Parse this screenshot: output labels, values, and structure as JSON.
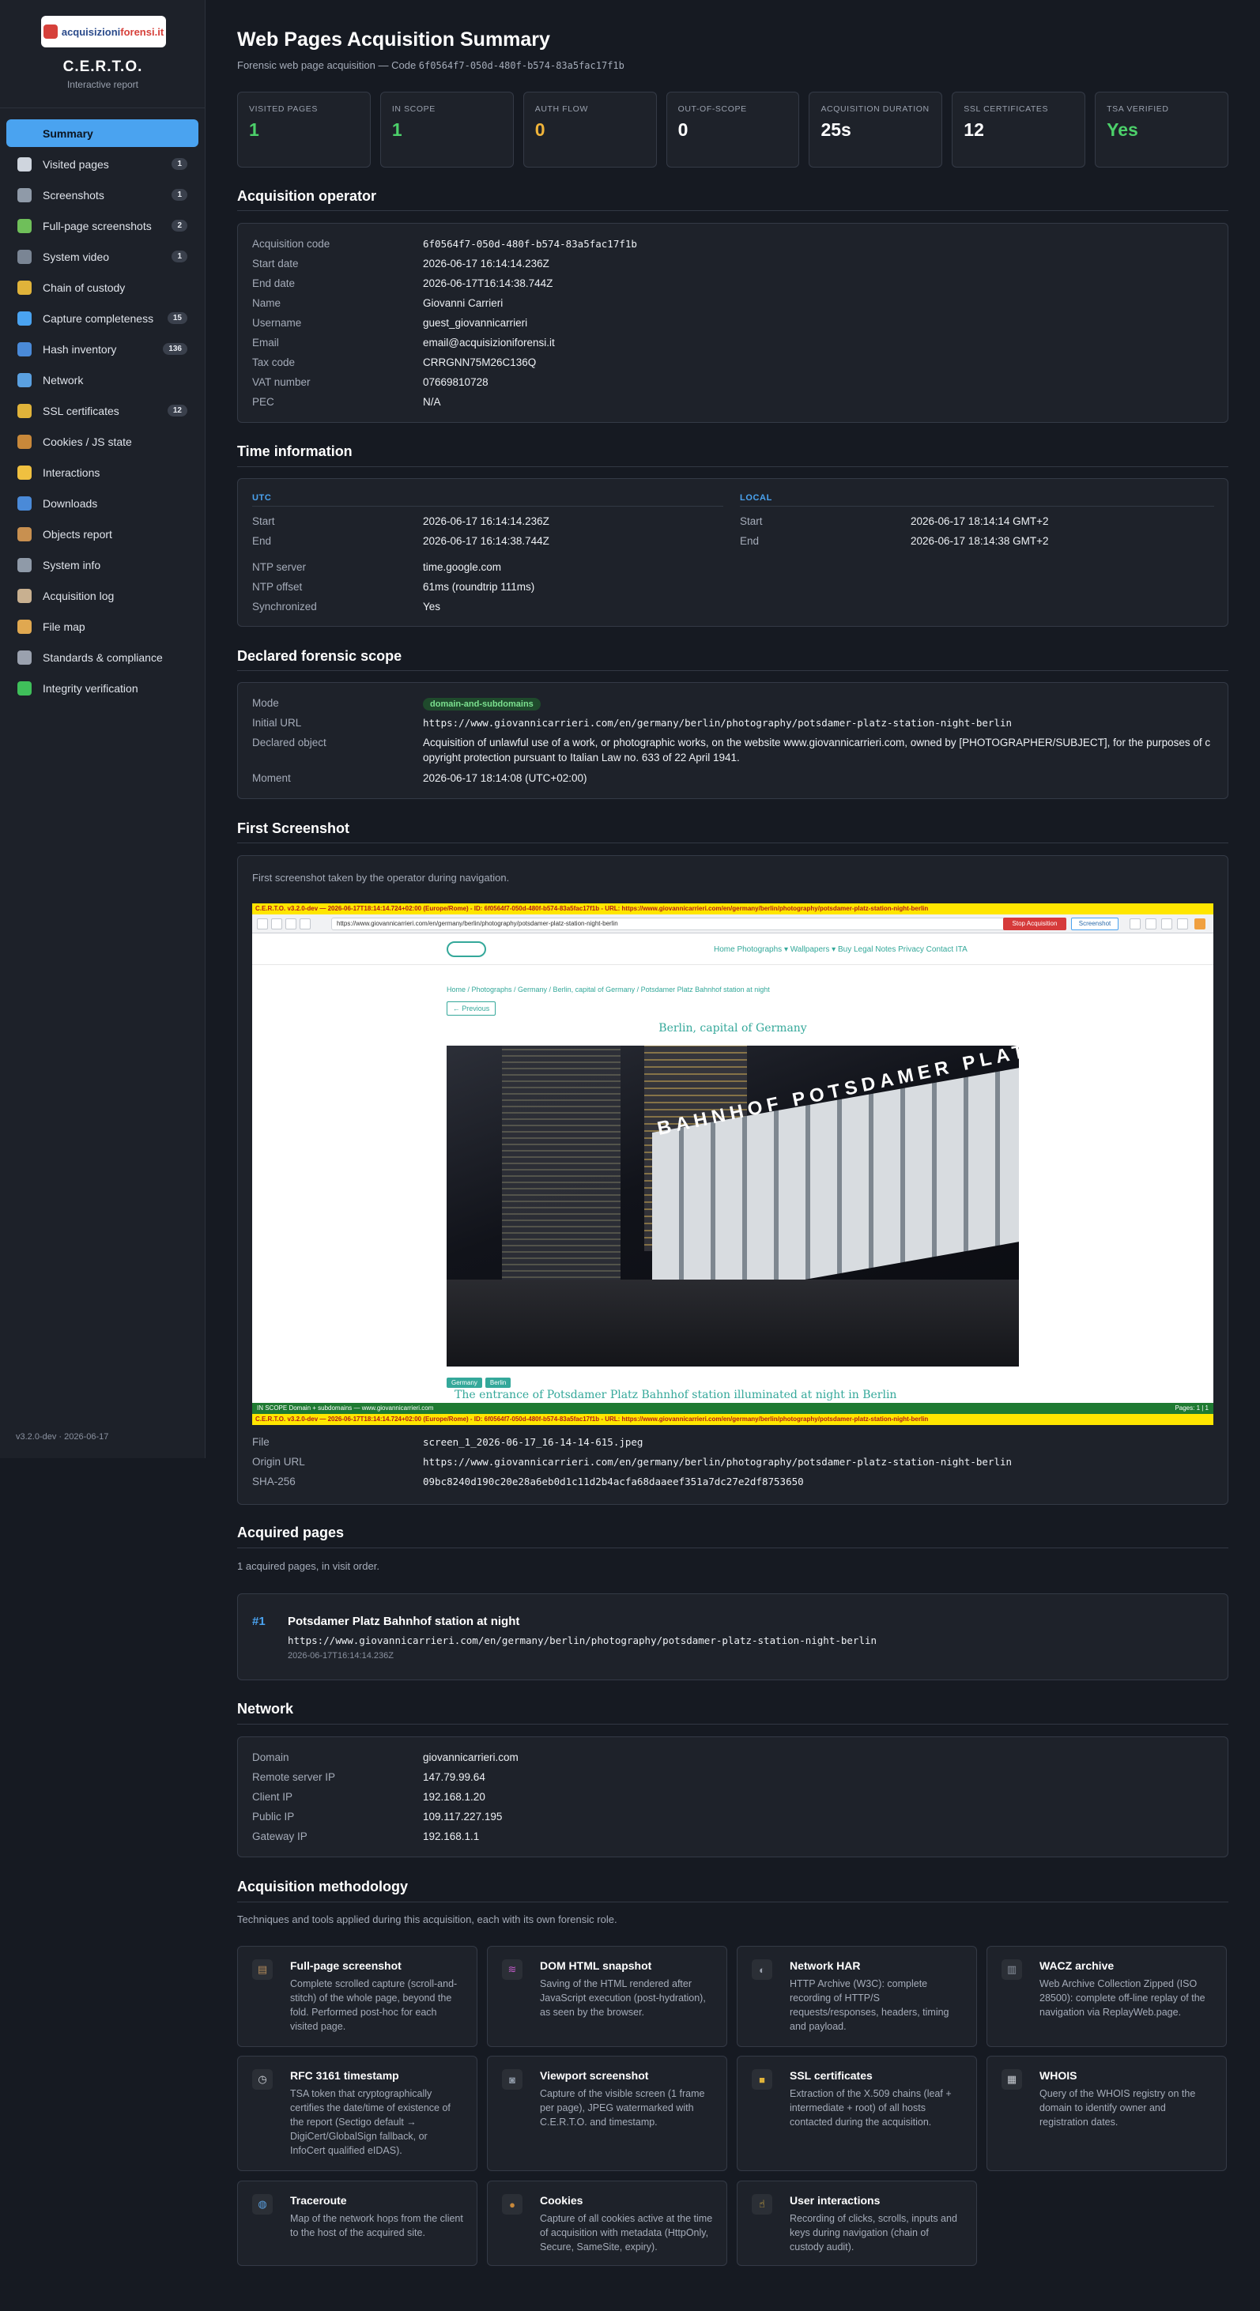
{
  "sidebar": {
    "logo_text_a": "acquisizioni",
    "logo_text_b": "forensi.it",
    "title": "C.E.R.T.O.",
    "subtitle": "Interactive report",
    "items": [
      {
        "label": "Summary",
        "badge": "",
        "icon": "bar-chart-icon",
        "color": "#4aa3f0"
      },
      {
        "label": "Visited pages",
        "badge": "1",
        "icon": "page-icon",
        "color": "#cfd5de"
      },
      {
        "label": "Screenshots",
        "badge": "1",
        "icon": "camera-icon",
        "color": "#8f9aa8"
      },
      {
        "label": "Full-page screenshots",
        "badge": "2",
        "icon": "picture-icon",
        "color": "#6fbf5a"
      },
      {
        "label": "System video",
        "badge": "1",
        "icon": "video-camera-icon",
        "color": "#7a8594"
      },
      {
        "label": "Chain of custody",
        "badge": "",
        "icon": "lock-key-icon",
        "color": "#e0b33a"
      },
      {
        "label": "Capture completeness",
        "badge": "15",
        "icon": "chart-icon",
        "color": "#4aa3f0"
      },
      {
        "label": "Hash inventory",
        "badge": "136",
        "icon": "hash-icon",
        "color": "#4a8ad8"
      },
      {
        "label": "Network",
        "badge": "",
        "icon": "globe-icon",
        "color": "#5aa0e0"
      },
      {
        "label": "SSL certificates",
        "badge": "12",
        "icon": "lock-icon",
        "color": "#e0b33a"
      },
      {
        "label": "Cookies / JS state",
        "badge": "",
        "icon": "cookie-icon",
        "color": "#c8883a"
      },
      {
        "label": "Interactions",
        "badge": "",
        "icon": "pointing-hand-icon",
        "color": "#f0c040"
      },
      {
        "label": "Downloads",
        "badge": "",
        "icon": "download-icon",
        "color": "#4a8ad8"
      },
      {
        "label": "Objects report",
        "badge": "",
        "icon": "box-icon",
        "color": "#c89050"
      },
      {
        "label": "System info",
        "badge": "",
        "icon": "laptop-icon",
        "color": "#8f9aa8"
      },
      {
        "label": "Acquisition log",
        "badge": "",
        "icon": "clipboard-icon",
        "color": "#c8b090"
      },
      {
        "label": "File map",
        "badge": "",
        "icon": "folder-icon",
        "color": "#e0a850"
      },
      {
        "label": "Standards & compliance",
        "badge": "",
        "icon": "gear-icon",
        "color": "#9aa1ae"
      },
      {
        "label": "Integrity verification",
        "badge": "",
        "icon": "check-icon",
        "color": "#3fbf5a"
      }
    ],
    "version": "v3.2.0-dev · 2026-06-17"
  },
  "header": {
    "title": "Web Pages Acquisition Summary",
    "subtitle_prefix": "Forensic web page acquisition — Code ",
    "code": "6f0564f7-050d-480f-b574-83a5fac17f1b"
  },
  "stats": [
    {
      "label": "VISITED PAGES",
      "value": "1",
      "color": "#4cd06a"
    },
    {
      "label": "IN SCOPE",
      "value": "1",
      "color": "#4cd06a"
    },
    {
      "label": "AUTH FLOW",
      "value": "0",
      "color": "#f0b43a"
    },
    {
      "label": "OUT-OF-SCOPE",
      "value": "0",
      "color": "#ffffff"
    },
    {
      "label": "ACQUISITION DURATION",
      "value": "25s",
      "color": "#ffffff"
    },
    {
      "label": "SSL CERTIFICATES",
      "value": "12",
      "color": "#ffffff"
    },
    {
      "label": "TSA VERIFIED",
      "value": "Yes",
      "color": "#4cd06a"
    }
  ],
  "operator": {
    "title": "Acquisition operator",
    "rows": [
      {
        "k": "Acquisition code",
        "v": "6f0564f7-050d-480f-b574-83a5fac17f1b"
      },
      {
        "k": "Start date",
        "v": "2026-06-17 16:14:14.236Z"
      },
      {
        "k": "End date",
        "v": "2026-06-17T16:14:38.744Z"
      },
      {
        "k": "Name",
        "v": "Giovanni Carrieri"
      },
      {
        "k": "Username",
        "v": "guest_giovannicarrieri"
      },
      {
        "k": "Email",
        "v": "email@acquisizioniforensi.it"
      },
      {
        "k": "Tax code",
        "v": "CRRGNN75M26C136Q"
      },
      {
        "k": "VAT number",
        "v": "07669810728"
      },
      {
        "k": "PEC",
        "v": "N/A"
      }
    ]
  },
  "time": {
    "title": "Time information",
    "utc_head": "UTC",
    "local_head": "LOCAL",
    "utc": [
      {
        "k": "Start",
        "v": "2026-06-17 16:14:14.236Z"
      },
      {
        "k": "End",
        "v": "2026-06-17 16:14:38.744Z"
      }
    ],
    "local": [
      {
        "k": "Start",
        "v": "2026-06-17 18:14:14 GMT+2"
      },
      {
        "k": "End",
        "v": "2026-06-17 18:14:38 GMT+2"
      }
    ],
    "ntp": [
      {
        "k": "NTP server",
        "v": "time.google.com"
      },
      {
        "k": "NTP offset",
        "v": "61ms (roundtrip 111ms)"
      },
      {
        "k": "Synchronized",
        "v": "Yes"
      }
    ]
  },
  "scope": {
    "title": "Declared forensic scope",
    "mode_k": "Mode",
    "mode_v": "domain-and-subdomains",
    "url_k": "Initial URL",
    "url_v": "https://www.giovannicarrieri.com/en/germany/berlin/photography/potsdamer-platz-station-night-berlin",
    "obj_k": "Declared object",
    "obj_v1": "Acquisition of unlawful use of a work, or photographic works, on the website www.giovannicarrieri.com, owned by [PHOTOGRAPHER/SUBJECT], for the purposes of c",
    "obj_v2": "opyright protection pursuant to Italian Law no. 633 of 22 April 1941.",
    "moment_k": "Moment",
    "moment_v": "2026-06-17 18:14:08 (UTC+02:00)"
  },
  "first_shot": {
    "title": "First Screenshot",
    "desc": "First screenshot taken by the operator during navigation.",
    "banner": "C.E.R.T.O. v3.2.0-dev — 2026-06-17T18:14:14.724+02:00 (Europe/Rome) - ID: 6f0564f7-050d-480f-b574-83a5fac17f1b - URL: https://www.giovannicarrieri.com/en/germany/berlin/photography/potsdamer-platz-station-night-berlin",
    "browser_url": "https://www.giovannicarrieri.com/en/germany/berlin/photography/potsdamer-platz-station-night-berlin",
    "stop_label": "Stop Acquisition",
    "shot_label": "Screenshot",
    "site_menu": "Home   Photographs ▾   Wallpapers ▾   Buy   Legal Notes   Privacy   Contact      ITA",
    "site_crumbs": "Home  /  Photographs  /  Germany  /  Berlin, capital of Germany  /  Potsdamer Platz Bahnhof station at night",
    "prev_label": "← Previous",
    "page_heading": "Berlin, capital of Germany",
    "photo_sign": "BAHNHOF POTSDAMER PLATZ",
    "tags": [
      "Germany",
      "Berlin"
    ],
    "caption": "The entrance of Potsdamer Platz Bahnhof station illuminated at night in Berlin",
    "scope_bar": "IN SCOPE   Domain + subdomains — www.giovannicarrieri.com",
    "pages_bar": "Pages: 1 | 1",
    "file_k": "File",
    "file_v": "screen_1_2026-06-17_16-14-14-615.jpeg",
    "origin_k": "Origin URL",
    "origin_v": "https://www.giovannicarrieri.com/en/germany/berlin/photography/potsdamer-platz-station-night-berlin",
    "sha_k": "SHA-256",
    "sha_v": "09bc8240d190c20e28a6eb0d1c11d2b4acfa68daaeef351a7dc27e2df8753650"
  },
  "acquired": {
    "title": "Acquired pages",
    "desc": "1 acquired pages, in visit order.",
    "num": "#1",
    "page_title": "Potsdamer Platz Bahnhof station at night",
    "url": "https://www.giovannicarrieri.com/en/germany/berlin/photography/potsdamer-platz-station-night-berlin",
    "time": "2026-06-17T16:14:14.236Z"
  },
  "network": {
    "title": "Network",
    "rows": [
      {
        "k": "Domain",
        "v": "giovannicarrieri.com"
      },
      {
        "k": "Remote server IP",
        "v": "147.79.99.64"
      },
      {
        "k": "Client IP",
        "v": "192.168.1.20"
      },
      {
        "k": "Public IP",
        "v": "109.117.227.195"
      },
      {
        "k": "Gateway IP",
        "v": "192.168.1.1"
      }
    ]
  },
  "methodology": {
    "title": "Acquisition methodology",
    "desc": "Techniques and tools applied during this acquisition, each with its own forensic role.",
    "items": [
      {
        "title": "Full-page screenshot",
        "desc": "Complete scrolled capture (scroll-and-stitch) of the whole page, beyond the fold. Performed post-hoc for each visited page.",
        "icon": "scroll-icon",
        "glyph": "▤",
        "color": "#b08a5a"
      },
      {
        "title": "DOM HTML snapshot",
        "desc": "Saving of the HTML rendered after JavaScript execution (post-hydration), as seen by the browser.",
        "icon": "dna-icon",
        "glyph": "≋",
        "color": "#c05ac8"
      },
      {
        "title": "Network HAR",
        "desc": "HTTP Archive (W3C): complete recording of HTTP/S requests/responses, headers, timing and payload.",
        "icon": "satellite-dish-icon",
        "glyph": "◐",
        "color": "#9aa1ae"
      },
      {
        "title": "WACZ archive",
        "desc": "Web Archive Collection Zipped (ISO 28500): complete off-line replay of the navigation via ReplayWeb.page.",
        "icon": "cabinet-icon",
        "glyph": "▥",
        "color": "#8a929e"
      },
      {
        "title": "RFC 3161 timestamp",
        "desc": "TSA token that cryptographically certifies the date/time of existence of the report (Sectigo default → DigiCert/GlobalSign fallback, or InfoCert qualified eIDAS).",
        "icon": "stopwatch-icon",
        "glyph": "◷",
        "color": "#d0d4da"
      },
      {
        "title": "Viewport screenshot",
        "desc": "Capture of the visible screen (1 frame per page), JPEG watermarked with C.E.R.T.O. and timestamp.",
        "icon": "camera-icon",
        "glyph": "◙",
        "color": "#8f9aa8"
      },
      {
        "title": "SSL certificates",
        "desc": "Extraction of the X.509 chains (leaf + intermediate + root) of all hosts contacted during the acquisition.",
        "icon": "lock-icon",
        "glyph": "■",
        "color": "#e0b33a"
      },
      {
        "title": "WHOIS",
        "desc": "Query of the WHOIS registry on the domain to identify owner and registration dates.",
        "icon": "card-index-icon",
        "glyph": "▦",
        "color": "#c8ccd2"
      },
      {
        "title": "Traceroute",
        "desc": "Map of the network hops from the client to the host of the acquired site.",
        "icon": "globe-icon",
        "glyph": "◍",
        "color": "#5aa0e0"
      },
      {
        "title": "Cookies",
        "desc": "Capture of all cookies active at the time of acquisition with metadata (HttpOnly, Secure, SameSite, expiry).",
        "icon": "cookie-icon",
        "glyph": "●",
        "color": "#c8883a"
      },
      {
        "title": "User interactions",
        "desc": "Recording of clicks, scrolls, inputs and keys during navigation (chain of custody audit).",
        "icon": "pointing-hand-icon",
        "glyph": "☝",
        "color": "#f0c040"
      }
    ]
  }
}
